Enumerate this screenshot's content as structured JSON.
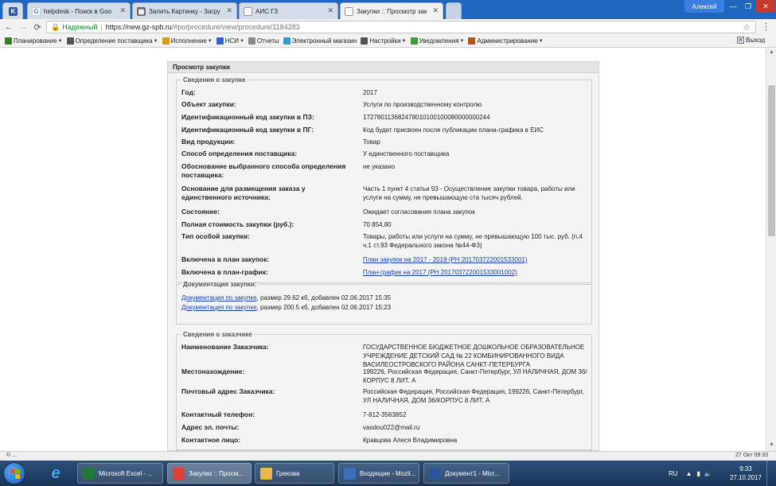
{
  "tabs": [
    {
      "favicon": "K",
      "favicon_color": "#2a5aa8",
      "label": ""
    },
    {
      "favicon": "G",
      "favicon_color": "#4285f4",
      "label": "helpdesk - Поиск в Goo"
    },
    {
      "favicon": "img",
      "favicon_color": "#6a6a6a",
      "label": "Залить Картинку - Загру"
    },
    {
      "favicon": "doc",
      "favicon_color": "#9a9a9a",
      "label": "АИС ГЗ"
    },
    {
      "favicon": "doc",
      "favicon_color": "#9a9a9a",
      "label": "Закупки :: Просмотр зак"
    }
  ],
  "window": {
    "user": "Алексей",
    "minimize": "—",
    "maximize": "❐",
    "close": "✕"
  },
  "address": {
    "secure_label": "Надежный",
    "url_host": "https://new.gz-spb.ru",
    "url_path": "/#po/procedure/view/procedure/1184283"
  },
  "menu": {
    "items": [
      {
        "label": "Планирование",
        "icon": "planning-icon",
        "color": "#3a7d2a"
      },
      {
        "label": "Определение поставщика",
        "icon": "supplier-icon",
        "color": "#555555"
      },
      {
        "label": "Исполнение",
        "icon": "execution-icon",
        "color": "#d69b19"
      },
      {
        "label": "НСИ",
        "icon": "reference-icon",
        "color": "#3366cc"
      },
      {
        "label": "Отчеты",
        "icon": "reports-icon",
        "color": "#888888"
      },
      {
        "label": "Электронный магазин",
        "icon": "shop-icon",
        "color": "#3399cc"
      },
      {
        "label": "Настройки",
        "icon": "settings-icon",
        "color": "#555555"
      },
      {
        "label": "Уведомления",
        "icon": "notifications-icon",
        "color": "#3a9d3a"
      },
      {
        "label": "Администрирование",
        "icon": "admin-icon",
        "color": "#b05a1a"
      }
    ],
    "exit_label": "Выход"
  },
  "page": {
    "title": "Просмотр закупки",
    "procurement": {
      "legend": "Сведения о закупке",
      "rows": [
        {
          "label": "Год:",
          "value": "2017"
        },
        {
          "label": "Объект закупки:",
          "value": "Услуги по производственному контролю"
        },
        {
          "label": "Идентификационный код закупки в ПЗ:",
          "value": "172780113682478010100100080000000244"
        },
        {
          "label": "Идентификационный код закупки в ПГ:",
          "value": "Код будет присвоен после публикации плана-графика в ЕИС"
        },
        {
          "label": "Вид продукции:",
          "value": "Товар"
        },
        {
          "label": "Способ определения поставщика:",
          "value": "У единственного поставщика"
        },
        {
          "label": "Обоснование выбранного способа определения поставщика:",
          "value": "не указано"
        },
        {
          "label": "Основание для размещения заказа у единственного источника:",
          "value": "Часть 1 пункт 4 статьи 93 - Осуществление закупки товара, работы или услуги на сумму, не превышающую ста тысяч рублей."
        },
        {
          "label": "Состояние:",
          "value": "Ожидает согласования плана закупок"
        },
        {
          "label": "Полная стоимость закупки (руб.):",
          "value": "70 854,80"
        },
        {
          "label": "Тип особой закупки:",
          "value": "Товары, работы или услуги на сумму, не превышающую 100 тыс. руб. (п.4 ч.1 ст.93 Федерального закона №44-ФЗ)"
        },
        {
          "label": "Включена в план закупок:",
          "value": "План закупок на 2017 - 2019 (РН 201703722001533001)",
          "link": true
        },
        {
          "label": "Включена в план-график:",
          "value": "План-график на 2017 (РН 201703722001533001002)",
          "link": true
        }
      ]
    },
    "documents": {
      "legend": "Документация закупки:",
      "items": [
        {
          "link": "Документация по закупке",
          "info": ", размер 29.62 кб, добавлен 02.06.2017 15:35"
        },
        {
          "link": "Документация по закупке",
          "info": ", размер 200.5 кб, добавлен 02.06.2017 15:23"
        }
      ]
    },
    "customer": {
      "legend": "Сведения о заказчике",
      "rows": [
        {
          "label": "Наименование Заказчика:",
          "value": "ГОСУДАРСТВЕННОЕ БЮДЖЕТНОЕ ДОШКОЛЬНОЕ ОБРАЗОВАТЕЛЬНОЕ УЧРЕЖДЕНИЕ ДЕТСКИЙ САД № 22 КОМБИНИРОВАННОГО ВИДА ВАСИЛЕОСТРОВСКОГО РАЙОНА САНКТ-ПЕТЕРБУРГА"
        },
        {
          "label": "Местонахождение:",
          "value": "199226, Российская Федерация, Санкт-Петербург, УЛ НАЛИЧНАЯ, ДОМ 36/КОРПУС 8 ЛИТ. А"
        },
        {
          "label": "Почтовый адрес Заказчика:",
          "value": "Российская Федерация, Российская Федерация, 199226, Санкт-Петербург, УЛ НАЛИЧНАЯ, ДОМ 36/КОРПУС 8 ЛИТ. А"
        },
        {
          "label": "Контактный телефон:",
          "value": "7-812-3563852"
        },
        {
          "label": "Адрес эл. почты:",
          "value": "vasdou022@mail.ru"
        },
        {
          "label": "Контактное лицо:",
          "value": "Кравцова Алеся Владимировна"
        }
      ]
    }
  },
  "statusbar": {
    "left": "© ...",
    "right": "27 Окт 09:33"
  },
  "taskbar": {
    "buttons": [
      {
        "label": "Microsoft Excel - ...",
        "icon": "excel-icon",
        "color": "#1f7a3a"
      },
      {
        "label": "Закупки :: Просм...",
        "icon": "chrome-icon",
        "color": "#db4437"
      },
      {
        "label": "Грекова",
        "icon": "folder-icon",
        "color": "#e8b84a"
      },
      {
        "label": "Входящие - Mozil...",
        "icon": "thunderbird-icon",
        "color": "#3a6fb8"
      },
      {
        "label": "Документ1 - Micr...",
        "icon": "word-icon",
        "color": "#2b579a"
      }
    ],
    "language": "RU",
    "time": "9:33",
    "date": "27.10.2017"
  }
}
